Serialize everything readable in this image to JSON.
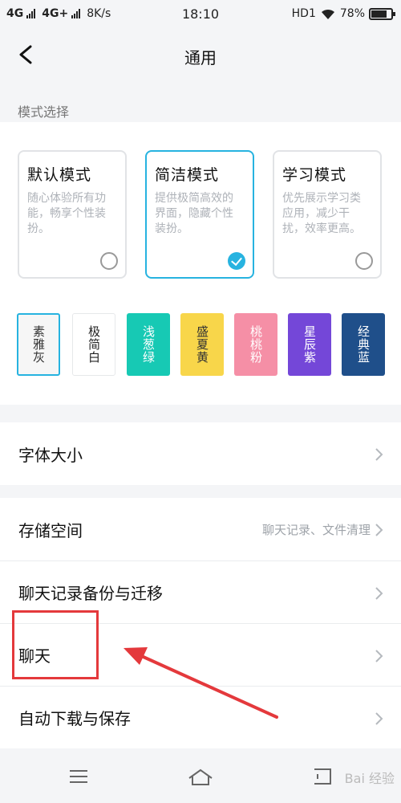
{
  "status_bar": {
    "net1": "4G",
    "net2": "4G+",
    "speed": "8K/s",
    "time": "18:10",
    "hd": "HD1",
    "battery": "78%",
    "battery_level": 0.78
  },
  "header": {
    "title": "通用"
  },
  "mode_section": {
    "label": "模式选择",
    "cards": [
      {
        "name": "默认模式",
        "desc": "随心体验所有功能，畅享个性装扮。",
        "checked": false
      },
      {
        "name": "简洁模式",
        "desc": "提供极简高效的界面，隐藏个性装扮。",
        "checked": true
      },
      {
        "name": "学习模式",
        "desc": "优先展示学习类应用，减少干扰，效率更高。",
        "checked": false
      }
    ],
    "themes": [
      {
        "label": "素雅灰",
        "bg": "#f6f6f6",
        "fg": "#333333",
        "selected": true
      },
      {
        "label": "极简白",
        "bg": "#ffffff",
        "fg": "#222222",
        "selected": false
      },
      {
        "label": "浅葱绿",
        "bg": "#17c9b4",
        "fg": "#ffffff",
        "selected": false
      },
      {
        "label": "盛夏黄",
        "bg": "#f8d64a",
        "fg": "#333333",
        "selected": false
      },
      {
        "label": "桃桃粉",
        "bg": "#f58fa6",
        "fg": "#ffffff",
        "selected": false
      },
      {
        "label": "星辰紫",
        "bg": "#7447d8",
        "fg": "#ffffff",
        "selected": false
      },
      {
        "label": "经典蓝",
        "bg": "#1f4f8a",
        "fg": "#ffffff",
        "selected": false
      }
    ]
  },
  "settings": {
    "font_size": "字体大小",
    "storage": "存储空间",
    "storage_hint": "聊天记录、文件清理",
    "backup": "聊天记录备份与迁移",
    "chat": "聊天",
    "auto_download": "自动下载与保存"
  },
  "watermark": "Bai 经验",
  "colors": {
    "accent": "#27b3e0",
    "annotation": "#e4393c"
  }
}
